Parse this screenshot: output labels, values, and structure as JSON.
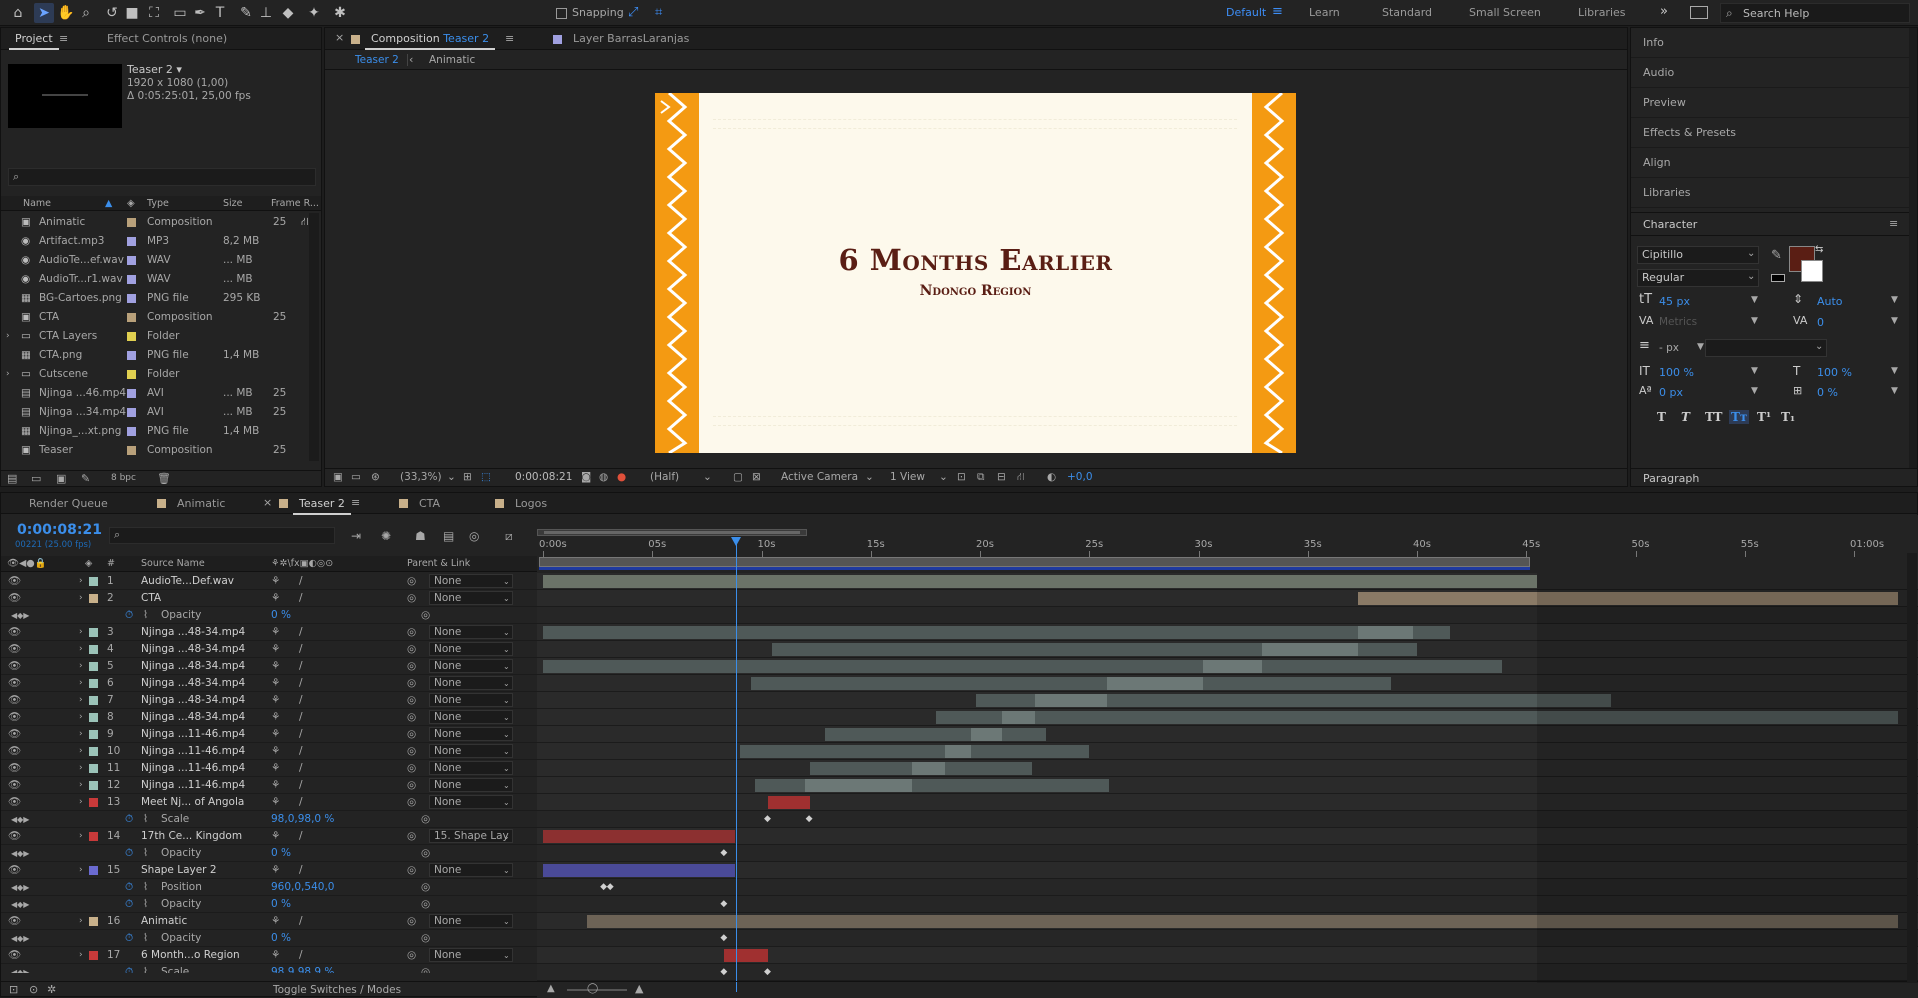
{
  "toolbar": {
    "snapping_label": "Snapping",
    "workspaces": [
      "Default",
      "Learn",
      "Standard",
      "Small Screen",
      "Libraries"
    ],
    "search_placeholder": "Search Help"
  },
  "project": {
    "tab_project": "Project",
    "tab_effect_controls": "Effect Controls (none)",
    "item_name": "Teaser 2 ▾",
    "item_resolution": "1920 x 1080 (1,00)",
    "item_duration": "Δ 0:05:25:01, 25,00 fps",
    "columns": {
      "name": "Name",
      "type": "Type",
      "size": "Size",
      "frame": "Frame R..."
    },
    "items": [
      {
        "name": "Animatic",
        "type": "Composition",
        "size": "",
        "frame": "25",
        "color": "#b8a07a",
        "icon": "comp-icon"
      },
      {
        "name": "Artifact.mp3",
        "type": "MP3",
        "size": "8,2 MB",
        "frame": "",
        "color": "#a0a0e0",
        "icon": "audio-icon"
      },
      {
        "name": "AudioTe...ef.wav",
        "type": "WAV",
        "size": "... MB",
        "frame": "",
        "color": "#a0a0e0",
        "icon": "audio-icon"
      },
      {
        "name": "AudioTr...r1.wav",
        "type": "WAV",
        "size": "... MB",
        "frame": "",
        "color": "#a0a0e0",
        "icon": "audio-icon"
      },
      {
        "name": "BG-Cartoes.png",
        "type": "PNG file",
        "size": "295 KB",
        "frame": "",
        "color": "#a0a0e0",
        "icon": "image-icon"
      },
      {
        "name": "CTA",
        "type": "Composition",
        "size": "",
        "frame": "25",
        "color": "#b8a07a",
        "icon": "comp-icon"
      },
      {
        "name": "CTA Layers",
        "type": "Folder",
        "size": "",
        "frame": "",
        "color": "#e0d050",
        "icon": "folder-icon"
      },
      {
        "name": "CTA.png",
        "type": "PNG file",
        "size": "1,4 MB",
        "frame": "",
        "color": "#a0a0e0",
        "icon": "image-icon"
      },
      {
        "name": "Cutscene",
        "type": "Folder",
        "size": "",
        "frame": "",
        "color": "#e0d050",
        "icon": "folder-icon"
      },
      {
        "name": "Njinga ...46.mp4",
        "type": "AVI",
        "size": "... MB",
        "frame": "25",
        "color": "#a0a0e0",
        "icon": "video-icon"
      },
      {
        "name": "Njinga ...34.mp4",
        "type": "AVI",
        "size": "... MB",
        "frame": "25",
        "color": "#a0a0e0",
        "icon": "video-icon"
      },
      {
        "name": "Njinga_...xt.png",
        "type": "PNG file",
        "size": "1,4 MB",
        "frame": "",
        "color": "#a0a0e0",
        "icon": "image-icon"
      },
      {
        "name": "Teaser",
        "type": "Composition",
        "size": "",
        "frame": "25",
        "color": "#b8a07a",
        "icon": "comp-icon"
      }
    ],
    "bpc": "8 bpc"
  },
  "composition": {
    "tab_label_prefix": "Composition",
    "tab_label_comp": "Teaser 2",
    "layer_tab": "Layer  BarrasLaranjas",
    "breadcrumb_current": "Teaser 2",
    "breadcrumb_parent": "Animatic",
    "title": "6 Months Earlier",
    "subtitle": "Ndongo Region",
    "zoom": "(33,3%)",
    "timecode": "0:00:08:21",
    "resolution": "(Half)",
    "camera": "Active Camera",
    "view": "1 View",
    "exposure": "+0,0"
  },
  "right_panel": {
    "items": [
      "Info",
      "Audio",
      "Preview",
      "Effects & Presets",
      "Align",
      "Libraries"
    ],
    "character_title": "Character",
    "font_family": "Cipitillo",
    "font_style": "Regular",
    "font_size": "45 px",
    "leading": "Auto",
    "kerning": "Metrics",
    "tracking": "0",
    "stroke_width": "- px",
    "vscale": "100 %",
    "hscale": "100 %",
    "baseline": "0 px",
    "tsume": "0 %",
    "fill_color": "#5a1e14",
    "paragraph_title": "Paragraph"
  },
  "timeline": {
    "tabs": [
      "Render Queue",
      "Animatic",
      "Teaser 2",
      "CTA",
      "Logos"
    ],
    "timecode": "0:00:08:21",
    "frame_info": "00221 (25.00 fps)",
    "col_source": "Source Name",
    "col_parent": "Parent & Link",
    "ruler": [
      "0:00s",
      "05s",
      "10s",
      "15s",
      "20s",
      "25s",
      "30s",
      "35s",
      "40s",
      "45s",
      "50s",
      "55s",
      "01:00s"
    ],
    "toggle_label": "Toggle Switches / Modes",
    "layers": [
      {
        "num": "1",
        "name": "AudioTe...Def.wav",
        "parent": "None",
        "color": "#9bc3b8",
        "type": "layer",
        "bar": [
          0.0,
          45.5
        ],
        "bar_color": "#6b7368"
      },
      {
        "num": "2",
        "name": "CTA",
        "parent": "None",
        "color": "#c8b08a",
        "type": "layer",
        "bar": [
          37.3,
          62.0
        ],
        "bar_color": "#8a7a66"
      },
      {
        "name": "Opacity",
        "value": "0 %",
        "type": "prop"
      },
      {
        "num": "3",
        "name": "Njinga ...48-34.mp4",
        "parent": "None",
        "color": "#9bc3b8",
        "type": "layer",
        "bar": [
          0.0,
          41.5
        ],
        "bar_color": "#4f5958",
        "hl": [
          37.3,
          39.8
        ]
      },
      {
        "num": "4",
        "name": "Njinga ...48-34.mp4",
        "parent": "None",
        "color": "#9bc3b8",
        "type": "layer",
        "bar": [
          10.5,
          40.0
        ],
        "bar_color": "#4f5958",
        "hl": [
          32.9,
          37.3
        ]
      },
      {
        "num": "5",
        "name": "Njinga ...48-34.mp4",
        "parent": "None",
        "color": "#9bc3b8",
        "type": "layer",
        "bar": [
          0.0,
          43.9
        ],
        "bar_color": "#4f5958",
        "hl": [
          30.2,
          32.9
        ]
      },
      {
        "num": "6",
        "name": "Njinga ...48-34.mp4",
        "parent": "None",
        "color": "#9bc3b8",
        "type": "layer",
        "bar": [
          9.5,
          38.8
        ],
        "bar_color": "#4f5958",
        "hl": [
          25.8,
          30.2
        ]
      },
      {
        "num": "7",
        "name": "Njinga ...48-34.mp4",
        "parent": "None",
        "color": "#9bc3b8",
        "type": "layer",
        "bar": [
          19.8,
          48.9
        ],
        "bar_color": "#4f5958",
        "hl": [
          22.5,
          25.8
        ]
      },
      {
        "num": "8",
        "name": "Njinga ...48-34.mp4",
        "parent": "None",
        "color": "#9bc3b8",
        "type": "layer",
        "bar": [
          18.0,
          62.0
        ],
        "bar_color": "#4f5958",
        "hl": [
          21.0,
          22.5
        ]
      },
      {
        "num": "9",
        "name": "Njinga ...11-46.mp4",
        "parent": "None",
        "color": "#9bc3b8",
        "type": "layer",
        "bar": [
          12.9,
          23.0
        ],
        "bar_color": "#4f5958",
        "hl": [
          19.6,
          21.0
        ]
      },
      {
        "num": "10",
        "name": "Njinga ...11-46.mp4",
        "parent": "None",
        "color": "#9bc3b8",
        "type": "layer",
        "bar": [
          9.0,
          25.0
        ],
        "bar_color": "#4f5958",
        "hl": [
          18.4,
          19.6
        ]
      },
      {
        "num": "11",
        "name": "Njinga ...11-46.mp4",
        "parent": "None",
        "color": "#9bc3b8",
        "type": "layer",
        "bar": [
          12.2,
          22.4
        ],
        "bar_color": "#4f5958",
        "hl": [
          16.9,
          18.4
        ]
      },
      {
        "num": "12",
        "name": "Njinga ...11-46.mp4",
        "parent": "None",
        "color": "#9bc3b8",
        "type": "layer",
        "bar": [
          9.7,
          25.9
        ],
        "bar_color": "#4f5958",
        "hl": [
          12.0,
          16.9
        ]
      },
      {
        "num": "13",
        "name": "Meet Nj... of Angola",
        "parent": "None",
        "color": "#c83a3a",
        "type": "layer",
        "bar": [
          10.3,
          12.2
        ],
        "bar_color": "#a03030"
      },
      {
        "name": "Scale",
        "value": "98,0,98,0 %",
        "type": "prop",
        "keys": [
          10.3,
          12.2
        ]
      },
      {
        "num": "14",
        "name": "17th Ce... Kingdom",
        "parent": "15. Shape Lay",
        "color": "#c83a3a",
        "type": "layer",
        "bar": [
          0.0,
          8.8
        ],
        "bar_color": "#8c3030"
      },
      {
        "name": "Opacity",
        "value": "0 %",
        "type": "prop",
        "keys": [
          8.3
        ]
      },
      {
        "num": "15",
        "name": "Shape Layer 2",
        "parent": "None",
        "color": "#6a6ad0",
        "type": "layer",
        "bar": [
          0.0,
          8.8
        ],
        "bar_color": "#4a4a98"
      },
      {
        "name": "Position",
        "value": "960,0,540,0",
        "type": "prop",
        "keys": [
          2.8,
          3.1
        ]
      },
      {
        "name": "Opacity",
        "value": "0 %",
        "type": "prop",
        "keys": [
          8.3
        ]
      },
      {
        "num": "16",
        "name": "Animatic",
        "parent": "None",
        "color": "#c8b08a",
        "type": "layer",
        "bar": [
          2.0,
          62.0
        ],
        "bar_color": "#6d6356"
      },
      {
        "name": "Opacity",
        "value": "0 %",
        "type": "prop",
        "keys": [
          8.3
        ]
      },
      {
        "num": "17",
        "name": "6 Month...o Region",
        "parent": "None",
        "color": "#c83a3a",
        "type": "layer",
        "bar": [
          8.3,
          10.3
        ],
        "bar_color": "#a03030"
      },
      {
        "name": "Scale",
        "value": "98,9,98,9 %",
        "type": "prop",
        "keys": [
          8.3,
          10.3
        ]
      }
    ]
  }
}
